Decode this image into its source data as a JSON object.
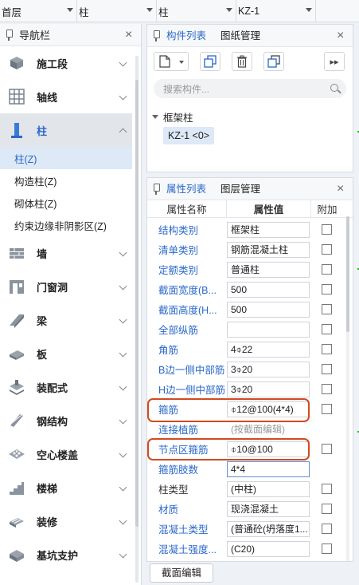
{
  "topbar": {
    "floor": "首层",
    "type": "柱",
    "subtype": "柱",
    "component": "KZ-1"
  },
  "nav": {
    "title": "导航栏",
    "items": [
      {
        "label": "施工段",
        "icon": "construction-segment-icon"
      },
      {
        "label": "轴线",
        "icon": "grid-axis-icon"
      },
      {
        "label": "柱",
        "icon": "column-icon",
        "active": true
      },
      {
        "label": "墙",
        "icon": "wall-icon"
      },
      {
        "label": "门窗洞",
        "icon": "door-window-icon"
      },
      {
        "label": "梁",
        "icon": "beam-icon"
      },
      {
        "label": "板",
        "icon": "slab-icon"
      },
      {
        "label": "装配式",
        "icon": "prefab-icon"
      },
      {
        "label": "钢结构",
        "icon": "steel-structure-icon"
      },
      {
        "label": "空心楼盖",
        "icon": "hollow-floor-icon"
      },
      {
        "label": "楼梯",
        "icon": "stairs-icon"
      },
      {
        "label": "装修",
        "icon": "decoration-icon"
      },
      {
        "label": "基坑支护",
        "icon": "foundation-pit-icon"
      }
    ],
    "sub_items": [
      "柱(Z)",
      "构造柱(Z)",
      "砌体柱(Z)",
      "约束边缘非阴影区(Z)"
    ]
  },
  "component_panel": {
    "tab_list": "构件列表",
    "tab_drawing": "图纸管理",
    "search_placeholder": "搜索构件...",
    "tree_root": "框架柱",
    "item": "KZ-1 <0>"
  },
  "property_panel": {
    "tab_props": "属性列表",
    "tab_layers": "图层管理",
    "col_name": "属性名称",
    "col_value": "属性值",
    "col_extra": "附加",
    "rows": [
      {
        "name": "结构类别",
        "value": "框架柱"
      },
      {
        "name": "清单类别",
        "value": "钢筋混凝土柱"
      },
      {
        "name": "定额类别",
        "value": "普通柱"
      },
      {
        "name": "截面宽度(B...",
        "value": "500"
      },
      {
        "name": "截面高度(H...",
        "value": "500"
      },
      {
        "name": "全部纵筋",
        "value": ""
      },
      {
        "name": "角筋",
        "value": "4⌽22"
      },
      {
        "name": "B边一侧中部筋",
        "value": "3⌽20"
      },
      {
        "name": "H边一侧中部筋",
        "value": "3⌽20"
      },
      {
        "name": "箍筋",
        "value": "⌽12@100(4*4)"
      },
      {
        "name": "连接植筋",
        "value": "(按截面编辑)"
      },
      {
        "name": "节点区箍筋",
        "value": "⌽10@100"
      },
      {
        "name": "箍筋肢数",
        "value": "4*4"
      },
      {
        "name": "柱类型",
        "value": "(中柱)"
      },
      {
        "name": "材质",
        "value": "现浇混凝土"
      },
      {
        "name": "混凝土类型",
        "value": "(普通砼(坍落度1..."
      },
      {
        "name": "混凝土强度...",
        "value": "(C20)"
      }
    ],
    "edit_button": "截面编辑"
  },
  "colors": {
    "accent": "#2a68c8",
    "highlight": "#d24a21"
  }
}
